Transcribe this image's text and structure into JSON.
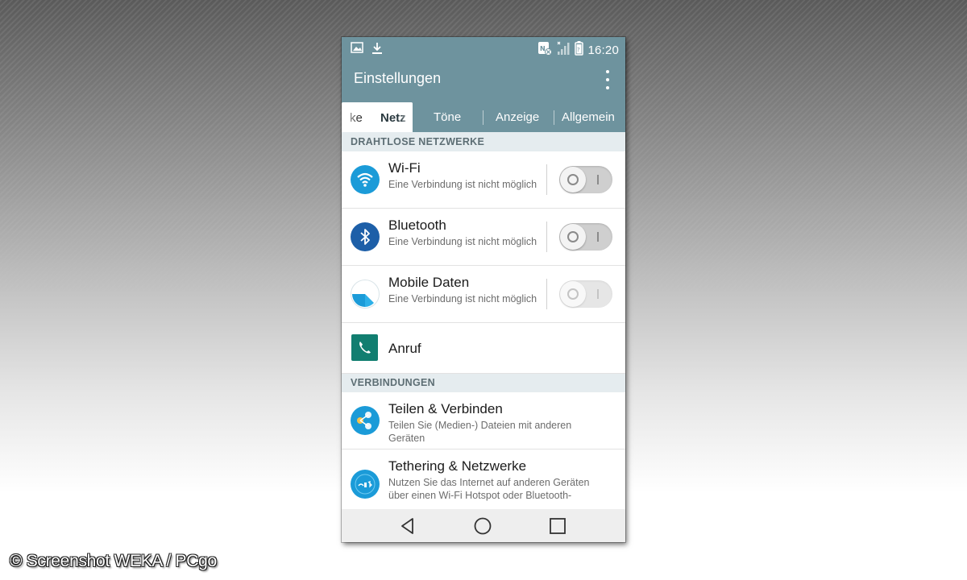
{
  "status_bar": {
    "time": "16:20",
    "left_icons": [
      "image-icon",
      "download-icon"
    ],
    "right_icons": [
      "nfc-icon",
      "signal-icon",
      "battery-icon"
    ]
  },
  "app_bar": {
    "title": "Einstellungen",
    "overflow_icon": "more-vert-icon"
  },
  "tabs": [
    {
      "label_prev": "ke",
      "label": "Netz",
      "active": true
    },
    {
      "label": "Töne",
      "active": false
    },
    {
      "label": "Anzeige",
      "active": false
    },
    {
      "label": "Allgemein",
      "active": false
    }
  ],
  "sections": [
    {
      "header": "DRAHTLOSE NETZWERKE",
      "items": [
        {
          "title": "Wi-Fi",
          "subtitle": "Eine Verbindung ist nicht möglich",
          "icon": "wifi-icon",
          "toggle": "off"
        },
        {
          "title": "Bluetooth",
          "subtitle": "Eine Verbindung ist nicht möglich",
          "icon": "bluetooth-icon",
          "toggle": "off"
        },
        {
          "title": "Mobile Daten",
          "subtitle": "Eine Verbindung ist nicht möglich",
          "icon": "mobile-data-icon",
          "toggle": "disabled"
        },
        {
          "title": "Anruf",
          "icon": "phone-icon"
        }
      ]
    },
    {
      "header": "VERBINDUNGEN",
      "items": [
        {
          "title": "Teilen & Verbinden",
          "subtitle": "Teilen Sie (Medien-) Dateien mit anderen Geräten",
          "icon": "share-connect-icon"
        },
        {
          "title": "Tethering & Netzwerke",
          "subtitle": "Nutzen Sie das Internet auf anderen Geräten über einen Wi-Fi Hotspot oder Bluetooth-",
          "icon": "tethering-icon"
        }
      ]
    }
  ],
  "nav_bar": {
    "buttons": [
      "back-icon",
      "home-icon",
      "recents-icon"
    ]
  },
  "watermark": "© Screenshot WEKA / PCgo",
  "colors": {
    "accent": "#6e939e",
    "section_bg": "#e5ecef",
    "icon_blue": "#1b9bd8",
    "bluetooth_blue": "#1d5fa8",
    "phone_teal": "#117e70"
  }
}
